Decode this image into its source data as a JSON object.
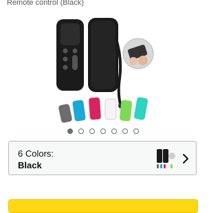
{
  "product": {
    "subtitle": "Remote control (Black)"
  },
  "carousel": {
    "dot_count": 7,
    "active_index": 0
  },
  "variation": {
    "label": "6 Colors:",
    "selected_value": "Black",
    "chevron_icon": "chevron-right-icon"
  },
  "colors": {
    "case_black": "#222222",
    "accent_blue": "#1aa8d8",
    "accent_red": "#d8245c",
    "accent_green": "#7ed957",
    "accent_teal": "#2dd4bf",
    "cta_yellow": "#ffd814"
  }
}
